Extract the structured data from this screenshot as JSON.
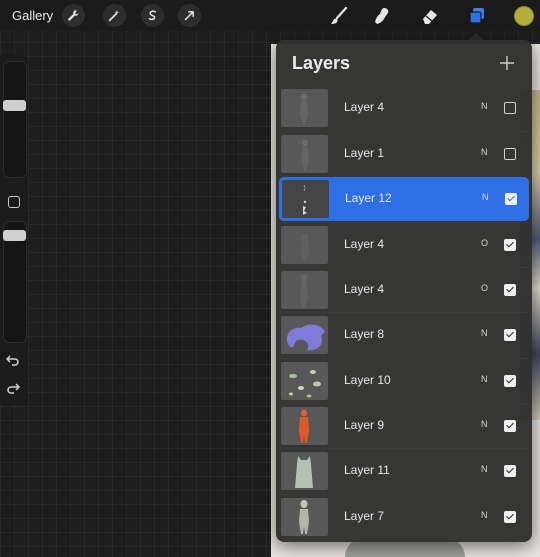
{
  "app": {
    "gallery_label": "Gallery"
  },
  "toolbar": {
    "left_tools": [
      {
        "icon": "wrench-icon"
      },
      {
        "icon": "magic-wand-icon"
      },
      {
        "icon": "selection-icon"
      },
      {
        "icon": "transform-arrow-icon"
      }
    ],
    "right_tools": [
      {
        "icon": "brush-icon"
      },
      {
        "icon": "smudge-icon"
      },
      {
        "icon": "eraser-icon"
      },
      {
        "icon": "layers-icon"
      }
    ],
    "current_color": "#b5ad3a",
    "accent": "#2f6fe6"
  },
  "layers_panel": {
    "title": "Layers",
    "add_symbol": "+",
    "layers": [
      {
        "name": "Layer 4",
        "blend": "N",
        "visible": false,
        "selected": false
      },
      {
        "name": "Layer 1",
        "blend": "N",
        "visible": false,
        "selected": false
      },
      {
        "name": "Layer 12",
        "blend": "N",
        "visible": true,
        "selected": true
      },
      {
        "name": "Layer 4",
        "blend": "O",
        "visible": true,
        "selected": false
      },
      {
        "name": "Layer 4",
        "blend": "O",
        "visible": true,
        "selected": false
      },
      {
        "name": "Layer 8",
        "blend": "N",
        "visible": true,
        "selected": false
      },
      {
        "name": "Layer 10",
        "blend": "N",
        "visible": true,
        "selected": false
      },
      {
        "name": "Layer 9",
        "blend": "N",
        "visible": true,
        "selected": false
      },
      {
        "name": "Layer 11",
        "blend": "N",
        "visible": true,
        "selected": false
      },
      {
        "name": "Layer 7",
        "blend": "N",
        "visible": true,
        "selected": false
      }
    ]
  }
}
